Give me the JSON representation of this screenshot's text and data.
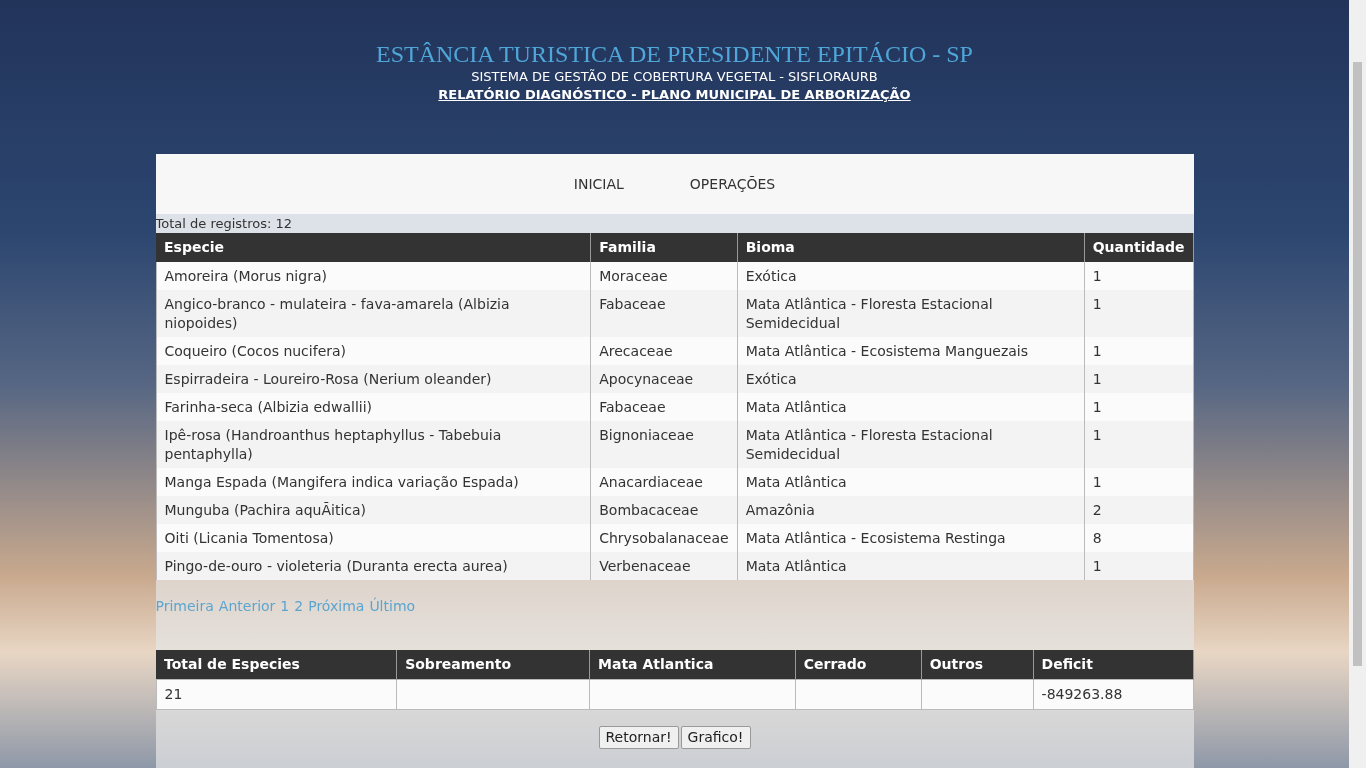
{
  "header": {
    "title": "ESTÂNCIA TURISTICA DE PRESIDENTE EPITÁCIO - SP",
    "subtitle": "SISTEMA DE GESTÃO DE COBERTURA VEGETAL - SISFLORAURB",
    "report_title": "RELATÓRIO DIAGNÓSTICO - PLANO MUNICIPAL DE ARBORIZAÇÃO"
  },
  "nav": [
    "INICIAL",
    "OPERAÇÕES"
  ],
  "record_count": "Total de registros: 12",
  "table": {
    "columns": [
      "Especie",
      "Familia",
      "Bioma",
      "Quantidade"
    ],
    "rows": [
      [
        "Amoreira (Morus nigra)",
        "Moraceae",
        "Exótica",
        "1"
      ],
      [
        "Angico-branco - mulateira - fava-amarela (Albizia niopoides)",
        "Fabaceae",
        "Mata Atlântica - Floresta Estacional Semidecidual",
        "1"
      ],
      [
        "Coqueiro (Cocos nucifera)",
        "Arecaceae",
        "Mata Atlântica - Ecosistema Manguezais",
        "1"
      ],
      [
        "Espirradeira - Loureiro-Rosa (Nerium oleander)",
        "Apocynaceae",
        "Exótica",
        "1"
      ],
      [
        "Farinha-seca (Albizia edwallii)",
        "Fabaceae",
        "Mata Atlântica",
        "1"
      ],
      [
        "Ipê-rosa (Handroanthus heptaphyllus - Tabebuia pentaphylla)",
        "Bignoniaceae",
        "Mata Atlântica - Floresta Estacional Semidecidual",
        "1"
      ],
      [
        "Manga Espada (Mangifera indica variação Espada)",
        "Anacardiaceae",
        "Mata Atlântica",
        "1"
      ],
      [
        "Munguba (Pachira aquÃitica)",
        "Bombacaceae",
        "Amazônia",
        "2"
      ],
      [
        "Oiti (Licania Tomentosa)",
        "Chrysobalanaceae",
        "Mata Atlântica - Ecosistema Restinga",
        "8"
      ],
      [
        "Pingo-de-ouro - violeteria (Duranta erecta aurea)",
        "Verbenaceae",
        "Mata Atlântica",
        "1"
      ]
    ]
  },
  "pagination": [
    "Primeira",
    "Anterior",
    "1",
    "2",
    "Próxima",
    "Último"
  ],
  "summary": {
    "columns": [
      {
        "label": "Total de Especies",
        "value": "21"
      },
      {
        "label": "Sobreamento"
      },
      {
        "label": "Mata Atlantica"
      },
      {
        "label": "Cerrado"
      },
      {
        "label": "Outros"
      },
      {
        "label": "Deficit",
        "value": "-849263.88"
      }
    ]
  },
  "buttons": [
    "Retornar!",
    "Grafico!"
  ]
}
